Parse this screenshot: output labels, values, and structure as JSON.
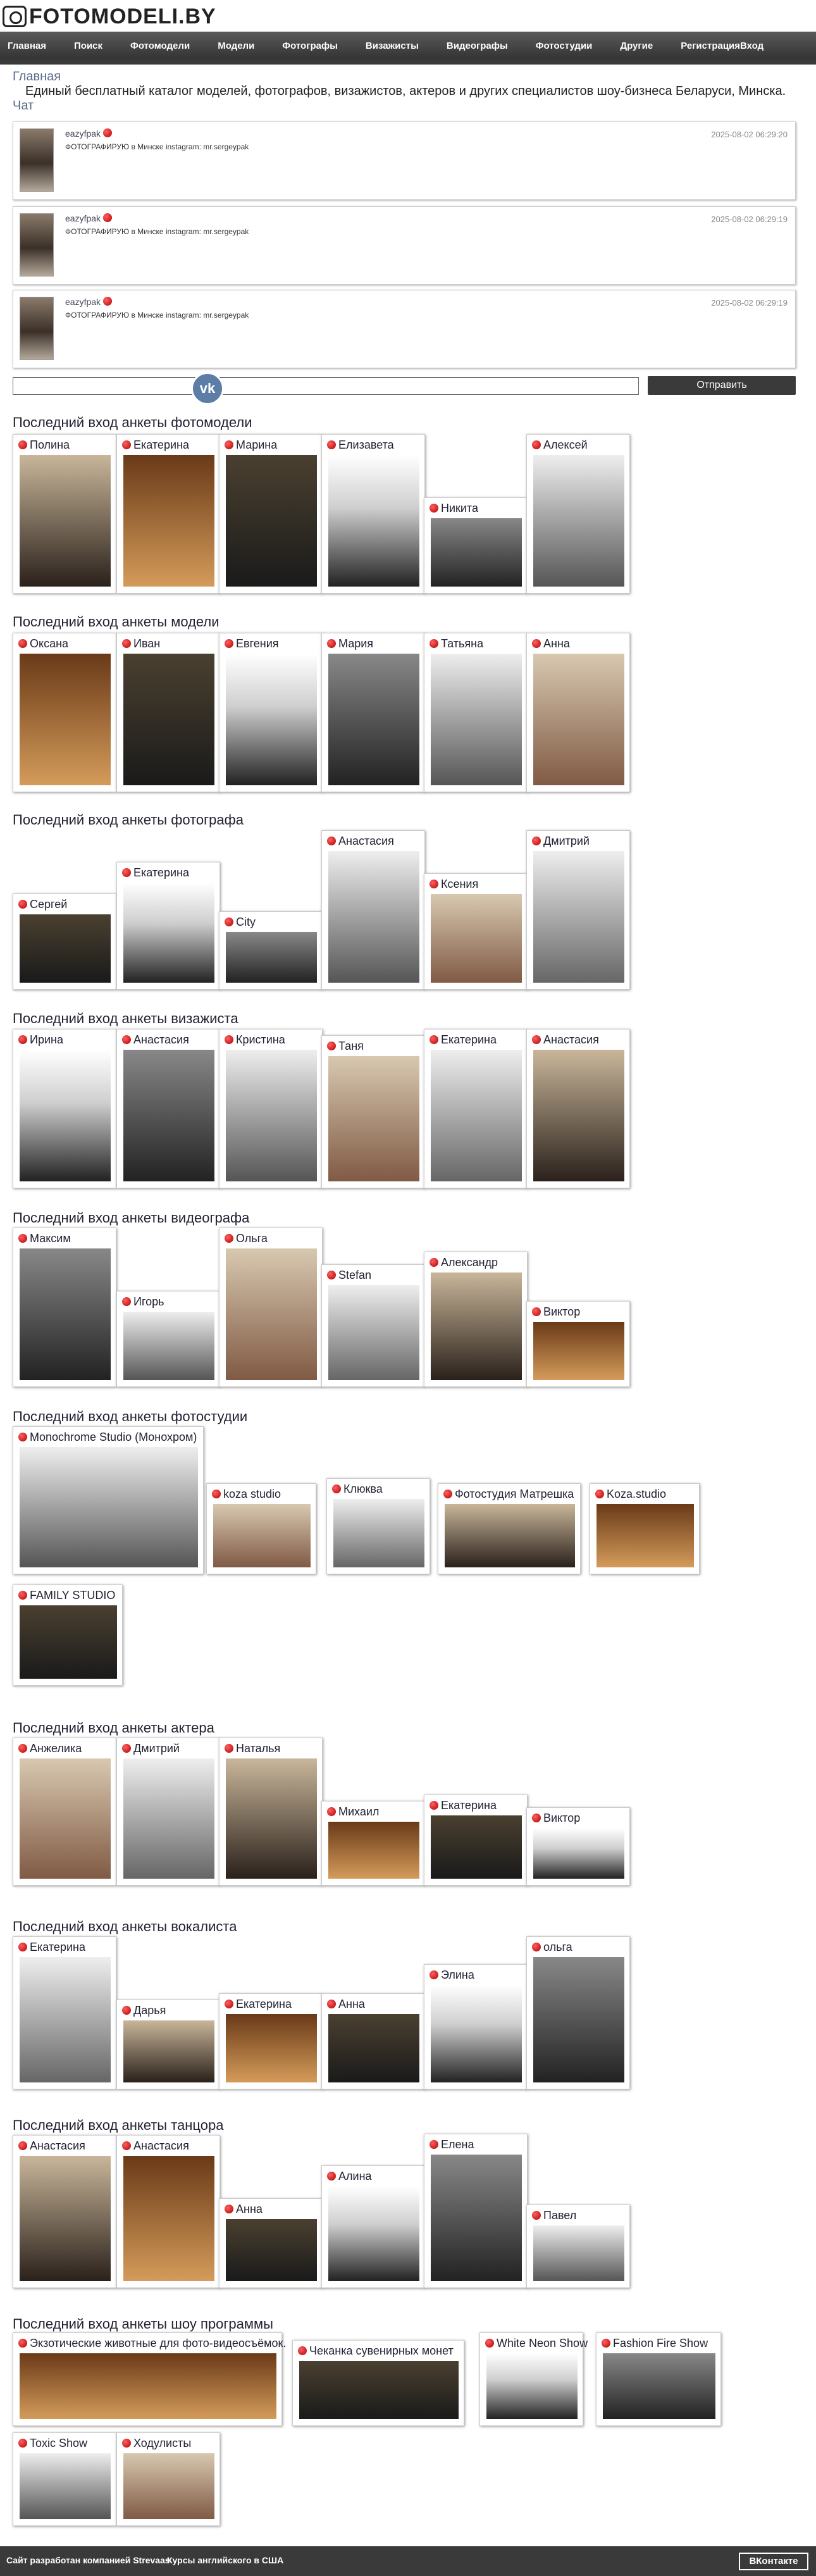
{
  "site": {
    "logo_text": "FOTOMODELI.BY"
  },
  "nav": [
    "Главная",
    "Поиск",
    "Фотомодели",
    "Модели",
    "Фотографы",
    "Визажисты",
    "Видеографы",
    "Фотостудии",
    "Другие",
    "РегистрацияВход"
  ],
  "breadcrumb": {
    "home": "Главная",
    "tagline": "Единый бесплатный каталог моделей, фотографов, визажистов, актеров и других специалистов шоу-бизнеса Беларуси, Минска.",
    "chat": "Чат"
  },
  "posts": [
    {
      "user": "eazyfpak",
      "date": "2025-08-02 06:29:20",
      "text": "ФОТОГРАФИРУЮ в Минске instagram: mr.sergeypak"
    },
    {
      "user": "eazyfpak",
      "date": "2025-08-02 06:29:19",
      "text": "ФОТОГРАФИРУЮ в Минске instagram: mr.sergeypak"
    },
    {
      "user": "eazyfpak",
      "date": "2025-08-02 06:29:19",
      "text": "ФОТОГРАФИРУЮ в Минске instagram: mr.sergeypak"
    }
  ],
  "chat": {
    "send": "Отправить",
    "vk_icon": "vk-icon"
  },
  "sections": [
    {
      "title": "Последний вход анкеты фотомодели",
      "items": [
        "Полина",
        "Екатерина",
        "Марина",
        "Елизавета",
        "Никита",
        "Алексей"
      ]
    },
    {
      "title": "Последний вход анкеты модели",
      "items": [
        "Оксана",
        "Иван",
        "Евгения",
        "Мария",
        "Татьяна",
        "Анна"
      ]
    },
    {
      "title": "Последний вход анкеты фотографа",
      "items": [
        "Сергей",
        "Екатерина",
        "City",
        "Анастасия",
        "Ксения",
        "Дмитрий"
      ]
    },
    {
      "title": "Последний вход анкеты визажиста",
      "items": [
        "Ирина",
        "Анастасия",
        "Кристина",
        "Таня",
        "Екатерина",
        "Анастасия"
      ]
    },
    {
      "title": "Последний вход анкеты видеографа",
      "items": [
        "Максим",
        "Игорь",
        "Ольга",
        "Stefan",
        "Александр",
        "Виктор"
      ]
    },
    {
      "title": "Последний вход анкеты фотостудии",
      "items": [
        "Monochrome Studio (Монохром)",
        "koza studio",
        "Клюква",
        "Фотостудия Матрешка",
        "Koza.studio",
        "FAMILY STUDIO"
      ]
    },
    {
      "title": "Последний вход анкеты актера",
      "items": [
        "Анжелика",
        "Дмитрий",
        "Наталья",
        "Михаил",
        "Екатерина",
        "Виктор"
      ]
    },
    {
      "title": "Последний вход анкеты вокалиста",
      "items": [
        "Екатерина",
        "Дарья",
        "Екатерина",
        "Анна",
        "Элина",
        "ольга"
      ]
    },
    {
      "title": "Последний вход анкеты танцора",
      "items": [
        "Анастасия",
        "Анастасия",
        "Анна",
        "Алина",
        "Елена",
        "Павел"
      ]
    },
    {
      "title": "Последний вход анкеты шоу программы",
      "items": [
        "Экзотические животные для фото-видеосъёмок.",
        "Чеканка сувенирных монет",
        "White Neon Show",
        "Fashion Fire Show",
        "Toxic Show",
        "Ходулисты"
      ]
    }
  ],
  "footer": {
    "dev": "Сайт разработан компанией Strevaas",
    "english": "Курсы английского в США",
    "vk": "ВКонтакте"
  }
}
